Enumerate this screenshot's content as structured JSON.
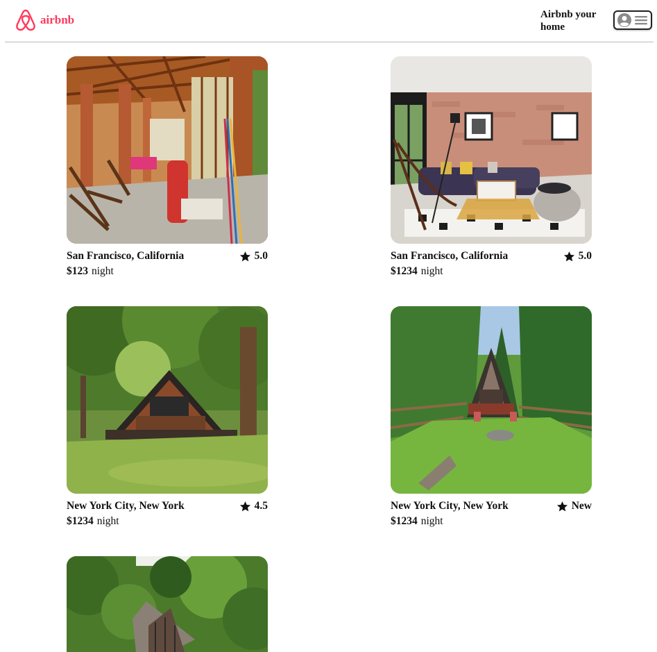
{
  "brand": {
    "name": "airbnb",
    "color": "#ff385c"
  },
  "header": {
    "host_link": "Airbnb your home",
    "menu_icons": [
      "user-icon",
      "hamburger-icon"
    ]
  },
  "listings": [
    {
      "location": "San Francisco, California",
      "rating": "5.0",
      "price": "$123",
      "unit": "night",
      "image": "sunroom-interior"
    },
    {
      "location": "San Francisco, California",
      "rating": "5.0",
      "price": "$1234",
      "unit": "night",
      "image": "brick-loft-living-room"
    },
    {
      "location": "New York City, New York",
      "rating": "4.5",
      "price": "$1234",
      "unit": "night",
      "image": "a-frame-cabin-forest"
    },
    {
      "location": "New York City, New York",
      "rating": "New",
      "price": "$1234",
      "unit": "night",
      "image": "a-frame-cabin-meadow"
    },
    {
      "location": "",
      "rating": "",
      "price": "",
      "unit": "",
      "image": "a-frame-aerial-trees"
    }
  ]
}
